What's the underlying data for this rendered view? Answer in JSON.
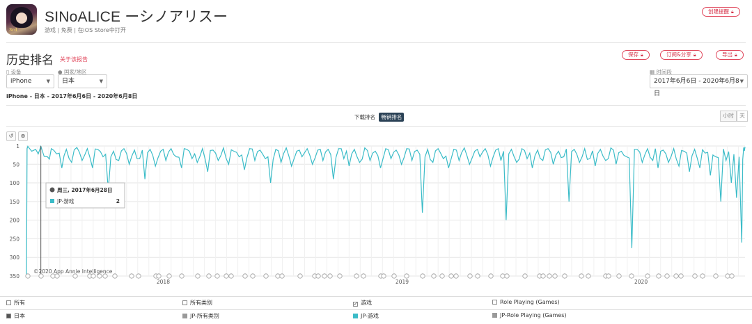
{
  "app": {
    "title": "SINoALICE ーシノアリスー",
    "meta": "游戏 | 免费 | 在iOS Store中打开",
    "icon": "app-icon-image",
    "create_alert_label": "创建提醒"
  },
  "report": {
    "title": "历史排名",
    "about_link": "关于该报告",
    "save_label": "保存",
    "subscribe_label": "订阅&分享",
    "export_label": "导出"
  },
  "filters": {
    "device_label": "设备",
    "device_value": "iPhone",
    "country_label": "国家/地区",
    "country_value": "日本",
    "period_label": "时间段",
    "period_value": "2017年6月6日 - 2020年6月8日"
  },
  "breadcrumb": "iPhone - 日本 - 2017年6月6日 - 2020年6月8日",
  "rank_toggle": {
    "download": "下载排名",
    "grossing": "畅销排名",
    "active": "grossing"
  },
  "granularity": {
    "hour": "小时",
    "day": "天"
  },
  "toolbar": {
    "reset_icon": "reset-icon",
    "zoom_icon": "zoom-icon"
  },
  "tooltip": {
    "date": "周三, 2017年6月28日",
    "series": "JP-游戏",
    "value": "2"
  },
  "watermark": "©2020 App Annie Intelligence",
  "legend": {
    "col_all": "所有",
    "col_all_categories": "所有类别",
    "col_games": "游戏",
    "col_rpg": "Role Playing (Games)",
    "row_country": "日本",
    "series_all_categories": "JP-所有类别",
    "series_games": "JP-游戏",
    "series_rpg": "JP-Role Playing (Games)"
  },
  "colors": {
    "accent": "#e0455a",
    "series": "#3bbcc8",
    "dark": "#2b4256",
    "grey_series": "#9a9a9a"
  },
  "chart_data": {
    "type": "line",
    "y_reversed": true,
    "yticks": [
      "1",
      "50",
      "100",
      "150",
      "200",
      "250",
      "300",
      "350"
    ],
    "ytick_values": [
      1,
      50,
      100,
      150,
      200,
      250,
      300,
      350
    ],
    "ylim": [
      1,
      350
    ],
    "xlim": [
      "2017-06-06",
      "2020-06-08"
    ],
    "xticks": [
      {
        "label": "2018",
        "date": "2018-01-01"
      },
      {
        "label": "2019",
        "date": "2019-01-01"
      },
      {
        "label": "2020",
        "date": "2020-01-01"
      }
    ],
    "grid": true,
    "series": [
      {
        "name": "JP-游戏",
        "points": [
          [
            "2017-06-06",
            350
          ],
          [
            "2017-06-08",
            2
          ],
          [
            "2017-06-20",
            10
          ],
          [
            "2017-06-28",
            2
          ],
          [
            "2017-07-08",
            30
          ],
          [
            "2017-07-14",
            8
          ],
          [
            "2017-07-22",
            22
          ],
          [
            "2017-07-30",
            60
          ],
          [
            "2017-08-06",
            10
          ],
          [
            "2017-08-14",
            45
          ],
          [
            "2017-08-22",
            5
          ],
          [
            "2017-08-30",
            40
          ],
          [
            "2017-09-07",
            8
          ],
          [
            "2017-09-15",
            60
          ],
          [
            "2017-09-23",
            10
          ],
          [
            "2017-10-01",
            30
          ],
          [
            "2017-10-09",
            120
          ],
          [
            "2017-10-17",
            15
          ],
          [
            "2017-10-25",
            40
          ],
          [
            "2017-11-02",
            8
          ],
          [
            "2017-11-10",
            50
          ],
          [
            "2017-11-18",
            12
          ],
          [
            "2017-11-26",
            35
          ],
          [
            "2017-12-04",
            90
          ],
          [
            "2017-12-12",
            10
          ],
          [
            "2017-12-20",
            55
          ],
          [
            "2017-12-28",
            15
          ],
          [
            "2018-01-05",
            40
          ],
          [
            "2018-01-13",
            8
          ],
          [
            "2018-01-21",
            30
          ],
          [
            "2018-01-29",
            60
          ],
          [
            "2018-02-06",
            10
          ],
          [
            "2018-02-14",
            35
          ],
          [
            "2018-02-22",
            45
          ],
          [
            "2018-03-02",
            8
          ],
          [
            "2018-03-10",
            70
          ],
          [
            "2018-03-18",
            12
          ],
          [
            "2018-03-26",
            40
          ],
          [
            "2018-04-03",
            6
          ],
          [
            "2018-04-11",
            50
          ],
          [
            "2018-04-19",
            15
          ],
          [
            "2018-04-27",
            30
          ],
          [
            "2018-05-05",
            65
          ],
          [
            "2018-05-13",
            8
          ],
          [
            "2018-05-21",
            40
          ],
          [
            "2018-05-29",
            12
          ],
          [
            "2018-06-06",
            35
          ],
          [
            "2018-06-14",
            100
          ],
          [
            "2018-06-22",
            10
          ],
          [
            "2018-06-30",
            45
          ],
          [
            "2018-07-08",
            6
          ],
          [
            "2018-07-16",
            55
          ],
          [
            "2018-07-24",
            15
          ],
          [
            "2018-08-01",
            30
          ],
          [
            "2018-08-09",
            8
          ],
          [
            "2018-08-17",
            50
          ],
          [
            "2018-08-25",
            12
          ],
          [
            "2018-09-02",
            40
          ],
          [
            "2018-09-10",
            10
          ],
          [
            "2018-09-18",
            90
          ],
          [
            "2018-09-26",
            8
          ],
          [
            "2018-10-04",
            35
          ],
          [
            "2018-10-12",
            55
          ],
          [
            "2018-10-20",
            10
          ],
          [
            "2018-10-28",
            45
          ],
          [
            "2018-11-05",
            6
          ],
          [
            "2018-11-13",
            40
          ],
          [
            "2018-11-21",
            15
          ],
          [
            "2018-11-29",
            60
          ],
          [
            "2018-12-07",
            8
          ],
          [
            "2018-12-15",
            35
          ],
          [
            "2018-12-23",
            12
          ],
          [
            "2018-12-31",
            50
          ],
          [
            "2019-01-08",
            8
          ],
          [
            "2019-01-16",
            40
          ],
          [
            "2019-01-24",
            12
          ],
          [
            "2019-02-01",
            180
          ],
          [
            "2019-02-09",
            10
          ],
          [
            "2019-02-17",
            45
          ],
          [
            "2019-02-25",
            8
          ],
          [
            "2019-03-05",
            35
          ],
          [
            "2019-03-13",
            60
          ],
          [
            "2019-03-21",
            10
          ],
          [
            "2019-03-29",
            40
          ],
          [
            "2019-04-06",
            6
          ],
          [
            "2019-04-14",
            50
          ],
          [
            "2019-04-22",
            15
          ],
          [
            "2019-04-30",
            30
          ],
          [
            "2019-05-08",
            8
          ],
          [
            "2019-05-16",
            55
          ],
          [
            "2019-05-24",
            12
          ],
          [
            "2019-06-01",
            40
          ],
          [
            "2019-06-09",
            200
          ],
          [
            "2019-06-17",
            10
          ],
          [
            "2019-06-25",
            45
          ],
          [
            "2019-07-03",
            8
          ],
          [
            "2019-07-11",
            35
          ],
          [
            "2019-07-19",
            60
          ],
          [
            "2019-07-27",
            12
          ],
          [
            "2019-08-04",
            40
          ],
          [
            "2019-08-12",
            8
          ],
          [
            "2019-08-20",
            50
          ],
          [
            "2019-08-28",
            15
          ],
          [
            "2019-09-05",
            30
          ],
          [
            "2019-09-13",
            150
          ],
          [
            "2019-09-21",
            10
          ],
          [
            "2019-09-29",
            45
          ],
          [
            "2019-10-07",
            8
          ],
          [
            "2019-10-15",
            35
          ],
          [
            "2019-10-23",
            55
          ],
          [
            "2019-10-31",
            10
          ],
          [
            "2019-11-08",
            40
          ],
          [
            "2019-11-16",
            6
          ],
          [
            "2019-11-24",
            50
          ],
          [
            "2019-12-02",
            15
          ],
          [
            "2019-12-10",
            30
          ],
          [
            "2019-12-18",
            275
          ],
          [
            "2019-12-26",
            10
          ],
          [
            "2020-01-03",
            45
          ],
          [
            "2020-01-11",
            8
          ],
          [
            "2020-01-19",
            40
          ],
          [
            "2020-01-27",
            60
          ],
          [
            "2020-02-04",
            12
          ],
          [
            "2020-02-12",
            45
          ],
          [
            "2020-02-20",
            8
          ],
          [
            "2020-02-28",
            55
          ],
          [
            "2020-03-07",
            15
          ],
          [
            "2020-03-15",
            70
          ],
          [
            "2020-03-23",
            10
          ],
          [
            "2020-03-31",
            60
          ],
          [
            "2020-04-08",
            20
          ],
          [
            "2020-04-16",
            80
          ],
          [
            "2020-04-24",
            30
          ],
          [
            "2020-05-02",
            150
          ],
          [
            "2020-05-10",
            40
          ],
          [
            "2020-05-18",
            100
          ],
          [
            "2020-05-26",
            140
          ],
          [
            "2020-06-03",
            260
          ],
          [
            "2020-06-06",
            5
          ],
          [
            "2020-06-08",
            3
          ]
        ]
      }
    ]
  }
}
